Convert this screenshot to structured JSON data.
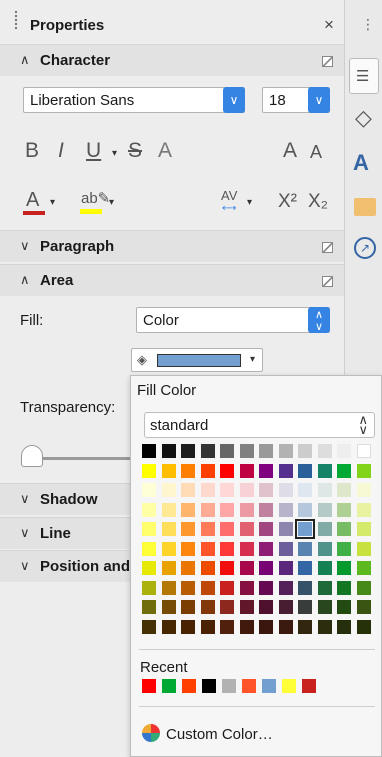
{
  "panel": {
    "title": "Properties",
    "close_glyph": "×"
  },
  "sections": {
    "character": "Character",
    "paragraph": "Paragraph",
    "area": "Area",
    "shadow": "Shadow",
    "line": "Line",
    "position": "Position and Size"
  },
  "character": {
    "font_name": "Liberation Sans",
    "font_size": "18",
    "bold": "B",
    "italic": "I",
    "underline": "U",
    "strike": "S",
    "shadow": "A",
    "grow": "A",
    "shrink": "A",
    "spacing": "AV",
    "superscript": "X²",
    "subscript": "X₂"
  },
  "area": {
    "fill_label": "Fill:",
    "fill_value": "Color",
    "transparency_label": "Transparency:",
    "current_color": "#729fcf"
  },
  "color_popup": {
    "title": "Fill Color",
    "palette": "standard",
    "recent_label": "Recent",
    "custom_label": "Custom Color…",
    "grid": [
      [
        "#000000",
        "#111111",
        "#1c1c1c",
        "#333333",
        "#666666",
        "#808080",
        "#999999",
        "#b2b2b2",
        "#cccccc",
        "#dddddd",
        "#eeeeee",
        "#ffffff"
      ],
      [
        "#ffff00",
        "#ffbf00",
        "#ff8000",
        "#ff4000",
        "#ff0000",
        "#bf0041",
        "#800080",
        "#55308d",
        "#2a6099",
        "#158466",
        "#00a933",
        "#81d41a"
      ],
      [
        "#ffffd7",
        "#fff5ce",
        "#ffdbb6",
        "#ffd8ce",
        "#ffd7d7",
        "#f7d1d5",
        "#e0c2cd",
        "#dedce6",
        "#dee6ef",
        "#dee7e5",
        "#dde8cb",
        "#f6f9d4"
      ],
      [
        "#ffffa6",
        "#ffe994",
        "#ffb66c",
        "#ffaa95",
        "#ffa6a6",
        "#ec9ba4",
        "#bf819e",
        "#b7b3ca",
        "#b4c7dc",
        "#b3cac7",
        "#afd095",
        "#e8f2a1"
      ],
      [
        "#ffff6d",
        "#ffde59",
        "#ff972f",
        "#ff7b59",
        "#ff6d6d",
        "#e16173",
        "#a1467e",
        "#8e86ae",
        "#729fcf",
        "#81aca6",
        "#77bc65",
        "#d4ea6b"
      ],
      [
        "#ffff38",
        "#ffd428",
        "#ff860d",
        "#ff5429",
        "#ff3838",
        "#d62e4e",
        "#8d1d75",
        "#6b5e9b",
        "#5983b0",
        "#50938a",
        "#3faf46",
        "#c9e13f"
      ],
      [
        "#e6e905",
        "#e8a202",
        "#ea7500",
        "#ed4c05",
        "#f10d0c",
        "#a7074b",
        "#780373",
        "#5b277d",
        "#3465a4",
        "#168253",
        "#069a2e",
        "#5eb91e"
      ],
      [
        "#acb20c",
        "#b47804",
        "#b85c00",
        "#be480a",
        "#c9211e",
        "#861141",
        "#650953",
        "#55215b",
        "#355269",
        "#1e6a39",
        "#127622",
        "#468a1a"
      ],
      [
        "#706e0c",
        "#784b04",
        "#7b3d00",
        "#813709",
        "#8d281e",
        "#611729",
        "#4e102d",
        "#481d32",
        "#383d3c",
        "#28471f",
        "#224b12",
        "#395511"
      ],
      [
        "#443205",
        "#472702",
        "#492300",
        "#4b2204",
        "#50200c",
        "#41190d",
        "#3b160e",
        "#3a1a0f",
        "#32260f",
        "#2c2d0c",
        "#262f0b",
        "#263009"
      ]
    ],
    "selected": "#729fcf",
    "recent": [
      "#ff0000",
      "#00a933",
      "#ff4000",
      "#000000",
      "#b2b2b2",
      "#ff5429",
      "#729fcf",
      "#ffff38",
      "#c9211e"
    ]
  }
}
